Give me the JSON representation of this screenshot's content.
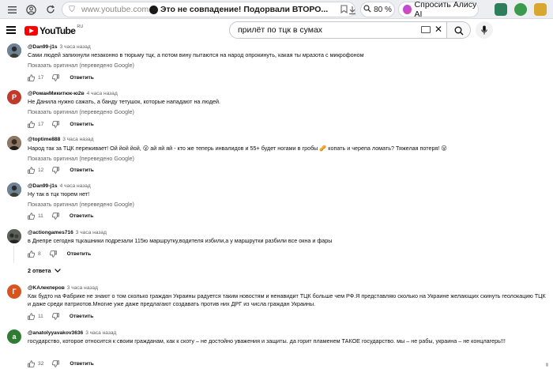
{
  "browser": {
    "url": "www.youtube.com",
    "tab_title": "Это не совпадение! Подорвали ВТОРО...",
    "zoom": "80 %",
    "alice_label": "Спросить Алису AI"
  },
  "header": {
    "logo_text": "YouTube",
    "logo_region": "RU",
    "search_query": "прилёт по тцк в сумах"
  },
  "comments": [
    {
      "author": "@Dan99-j1s",
      "time": "3 часа назад",
      "text": [
        "Сами людей запихнули незаконно в тюрьму тцк, а потом вину пытаются на народ опрокинуть, какая ты мразота с микрофоном"
      ],
      "translate": "Показать оригинал (переведено Google)",
      "likes": "17",
      "reply": "Ответить",
      "avatar_color": "#5f7386",
      "avatar_letter": ""
    },
    {
      "author": "@РоманМикитюк-ю2в",
      "time": "4 часа назад",
      "text": [
        "Не Данила нужно сажать, а банду тетушок, которые нападают на людей."
      ],
      "translate": "Показать оригинал (переведено Google)",
      "likes": "17",
      "reply": "Ответить",
      "avatar_color": "#c0392b",
      "avatar_letter": "Р"
    },
    {
      "author": "@toptime888",
      "time": "3 часа назад",
      "text": [
        "Народ так за ТЦК переживает! Ой йой йой, 😮 ай яй яй - кто же теперь инвалидов и 55+ будет ногами в гробы 🥜 копать и черепа ломать? Тяжелая потеря! 😮"
      ],
      "translate": "Показать оригинал (переведено Google)",
      "likes": "12",
      "reply": "Ответить",
      "avatar_color": "#6b5a4a",
      "avatar_letter": ""
    },
    {
      "author": "@Dan99-j1s",
      "time": "4 часа назад",
      "text": [
        "Ну так в тцк тюрем нет!"
      ],
      "translate": "Показать оригинал (переведено Google)",
      "likes": "11",
      "reply": "Ответить",
      "avatar_color": "#5f7386",
      "avatar_letter": ""
    },
    {
      "author": "@actiongames716",
      "time": "3 часа назад",
      "text": [
        "в Днепре сегодня тцкашники подрезали 115ю маршрутку,водителя избили,а у маршрутки разбили все окна и фары"
      ],
      "translate": "",
      "likes": "8",
      "reply": "Ответить",
      "avatar_color": "#4a4f47",
      "avatar_letter": "",
      "replies_label": "2 ответа"
    },
    {
      "author": "@KAлекперов",
      "time": "3 часа назад",
      "text": [
        "Как будто на Фабрике не знают о том сколько граждан Украины радуется таким новостям и ненавидит ТЦК больше чем РФ.Я представляю сколько на Украине желающих скинуть геолокацию ТЦК",
        "и даже среди патриотов.Многие уже даже предлагают создавать против них ДРГ из числа граждан Украины."
      ],
      "translate": "",
      "likes": "11",
      "reply": "Ответить",
      "avatar_color": "#d7541e",
      "avatar_letter": "Г"
    },
    {
      "author": "@anatolyyavakov3636",
      "time": "3 часа назад",
      "text": [
        "государство, которое относится к своим гражданам, как к скоту – не достойно уважения и защиты.  да горит пламенем ТАКОЕ государство.  мы – не рабы, украина – не концлагерь!!!"
      ],
      "translate": "",
      "likes": "32",
      "reply": "Ответить",
      "avatar_color": "#2e7d32",
      "avatar_letter": "a"
    }
  ]
}
